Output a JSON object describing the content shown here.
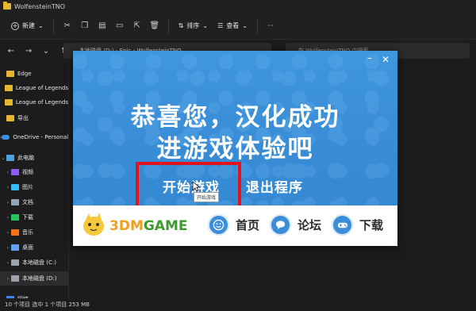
{
  "window": {
    "title": "WolfensteinTNO"
  },
  "toolbar": {
    "new_label": "新建",
    "sort_label": "排序",
    "view_label": "查看",
    "more_label": "···"
  },
  "address": {
    "path": "本地磁盘 (D:) › Epic › WolfensteinTNO",
    "search_placeholder": "在 WolfensteinTNO 中搜索"
  },
  "sidebar": {
    "items": [
      {
        "label": "Edge"
      },
      {
        "label": "League of Legends"
      },
      {
        "label": "League of Legends"
      },
      {
        "label": "导出"
      },
      {
        "label": "OneDrive - Personal"
      },
      {
        "label": "此电脑"
      },
      {
        "label": "视频"
      },
      {
        "label": "图片"
      },
      {
        "label": "文档"
      },
      {
        "label": "下载"
      },
      {
        "label": "音乐"
      },
      {
        "label": "桌面"
      },
      {
        "label": "本地磁盘 (C:)"
      },
      {
        "label": "本地磁盘 (D:)"
      },
      {
        "label": "网络"
      }
    ]
  },
  "status": {
    "text": "10 个项目   选中 1 个项目  253 MB"
  },
  "dialog": {
    "headline_1": "恭喜您，汉化成功",
    "headline_2": "进游戏体验吧",
    "start_button": "开始游戏",
    "exit_button": "退出程序",
    "tooltip": "开始游戏",
    "brand": {
      "num": "3DM",
      "word": "GAME"
    },
    "nav": [
      {
        "label": "首页",
        "icon": "smile-icon"
      },
      {
        "label": "论坛",
        "icon": "chat-icon"
      },
      {
        "label": "下载",
        "icon": "gamepad-icon"
      }
    ],
    "close_glyph": "✕",
    "min_glyph": "–"
  },
  "colors": {
    "dialog_blue": "#3a8ed8",
    "highlight_red": "#e0141e",
    "brand_green": "#3d9a2e",
    "brand_orange": "#f0a020"
  }
}
